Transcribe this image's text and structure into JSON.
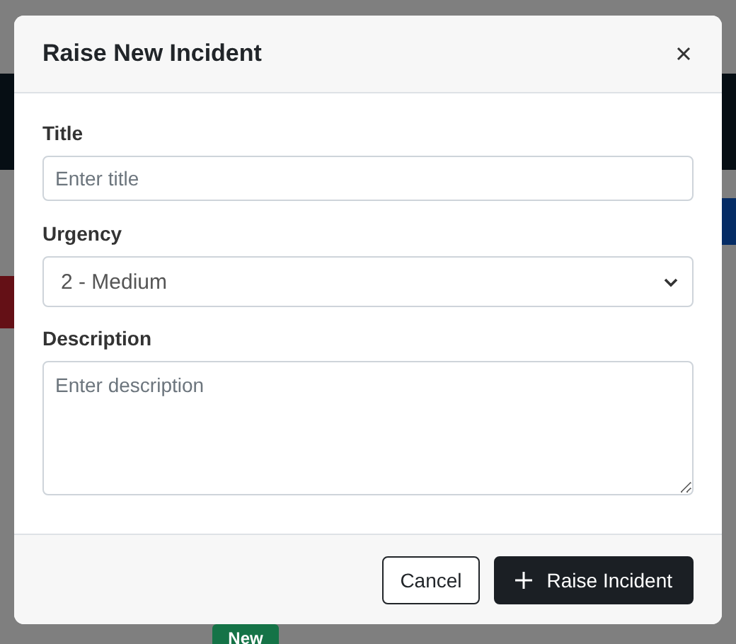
{
  "background": {
    "badge": "New"
  },
  "dialog": {
    "title": "Raise New Incident",
    "fields": [
      {
        "kind": "text",
        "label": "Title",
        "placeholder": "Enter title"
      },
      {
        "kind": "select",
        "label": "Urgency",
        "value": "2 - Medium"
      },
      {
        "kind": "textarea",
        "label": "Description",
        "placeholder": "Enter description"
      }
    ],
    "buttons": [
      {
        "kind": "secondary",
        "label": "Cancel"
      },
      {
        "kind": "primary",
        "label": "Raise Incident"
      }
    ]
  }
}
